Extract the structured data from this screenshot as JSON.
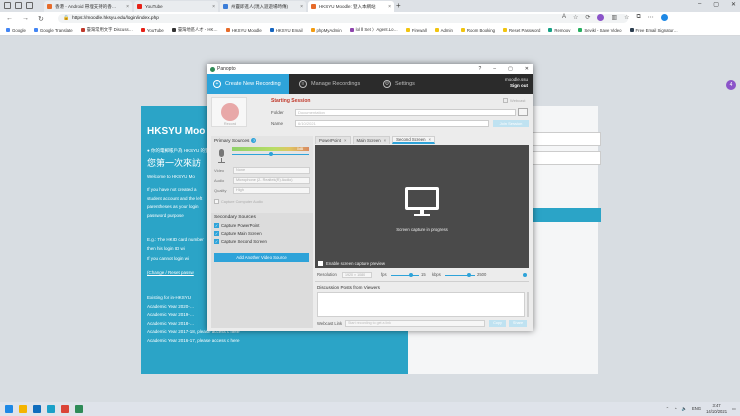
{
  "browser": {
    "tabs": [
      {
        "title": "香港 - Android 帶埋支持的香…",
        "color": "#e66b2a",
        "active": false
      },
      {
        "title": "YouTube",
        "color": "#e62117",
        "active": false
      },
      {
        "title": "州靈即進人(現入遊遊場時傳)",
        "color": "#3b7dd8",
        "active": false
      },
      {
        "title": "HKSYU Moodle: 登入本網站",
        "color": "#e66b2a",
        "active": true
      }
    ],
    "new_tab_glyph": "+",
    "url": "https://moodle.hksyu.edu/login/index.php",
    "bookmarks": [
      {
        "label": "Google",
        "color": "#4285f4"
      },
      {
        "label": "Google Translate",
        "color": "#4285f4"
      },
      {
        "label": "臺灣常用文字 Discuss…",
        "color": "#c0392b"
      },
      {
        "label": "YouTube",
        "color": "#e62117"
      },
      {
        "label": "臺灣地區人才 - HK…",
        "color": "#333333"
      },
      {
        "label": "HKSYU Moodle",
        "color": "#e66b2a"
      },
      {
        "label": "HKSYU Email",
        "color": "#1565c0"
      },
      {
        "label": "phpMyAdmin",
        "color": "#f39c12"
      },
      {
        "label": "lol Ⅱ Set 〉Agent.Lo…",
        "color": "#8e44ad"
      },
      {
        "label": "Firewall",
        "color": "#f1c40f"
      },
      {
        "label": "Admin",
        "color": "#f1c40f"
      },
      {
        "label": "Room Booking",
        "color": "#f1c40f"
      },
      {
        "label": "Reset Password",
        "color": "#f1c40f"
      },
      {
        "label": "Remoov",
        "color": "#16a085"
      },
      {
        "label": "Sevikl - Save Video",
        "color": "#27ae60"
      },
      {
        "label": "Free Email Signatur…",
        "color": "#2c3e50"
      }
    ],
    "side_badge": "4"
  },
  "background_page": {
    "heading": "HKSYU Moo",
    "line1": "● 你的電郵帳戶為 HKSYU 的登入名稱",
    "line2": "您第一次來訪",
    "line3": "Welcome to HKSYU Mo",
    "para1": "If you have not created a student account and the left parentheses as your login password purpose",
    "para2": "E.g.: The HKID card number then his login ID wi",
    "para3": "If you cannot login wi",
    "link1": "(Change / Reset passw",
    "table_lines": [
      "Existing for in-HKSYU",
      "Academic Year 2020-…",
      "Academic Year 2019-…",
      "Academic Year 2018-…",
      "Academic Year 2017-18, please access c here",
      "Academic Year 2016-17, please access c here"
    ]
  },
  "panopto": {
    "title": "Panopto",
    "window_controls": [
      "?",
      "–",
      "▢",
      "✕"
    ],
    "tabs": [
      {
        "label": "Create New Recording",
        "icon": "+",
        "active": true
      },
      {
        "label": "Manage Recordings",
        "icon": "≡",
        "active": false
      },
      {
        "label": "Settings",
        "icon": "⚙",
        "active": false
      }
    ],
    "user": {
      "name": "moodle.ssu",
      "action": "Sign out"
    },
    "record_label": "Record",
    "section_title": "Starting Session",
    "webcast_label": "Webcast",
    "folder_label": "Folder",
    "folder_value": "Documentation",
    "name_label": "Name",
    "name_value": "6/10/2021",
    "join_button": "Join Session",
    "primary_sources": {
      "title": "Primary Sources",
      "help": "?",
      "meter_label": "0dB",
      "audio_level": 0.5,
      "rows": [
        {
          "label": "Video",
          "value": "None"
        },
        {
          "label": "Audio",
          "value": "Microphone (2- Realtek(R) Audio)"
        },
        {
          "label": "Quality",
          "value": "High"
        }
      ],
      "capture_label": "Capture Computer Audio"
    },
    "secondary_sources": {
      "title": "Secondary Sources",
      "items": [
        {
          "label": "Capture PowerPoint",
          "checked": true
        },
        {
          "label": "Capture Main Screen",
          "checked": true
        },
        {
          "label": "Capture Second Screen",
          "checked": true
        }
      ],
      "add_button": "Add Another Video Source"
    },
    "source_tabs": [
      {
        "label": "PowerPoint",
        "active": false
      },
      {
        "label": "Main Screen",
        "active": false
      },
      {
        "label": "Second Screen",
        "active": true
      }
    ],
    "preview_text": "Screen capture in progress",
    "enable_preview": "Enable screen capture preview",
    "settings": {
      "resolution_label": "Resolution",
      "resolution_value": "1920 × 1080",
      "fps_label": "fps",
      "fps_value": "15",
      "fps_level": 0.7,
      "kbps_label": "kbps",
      "kbps_value": "2500",
      "kbps_level": 0.8
    },
    "discussion_title": "Discussion Posts from Viewers",
    "webcast_link_label": "Webcast Link",
    "webcast_link_placeholder": "Start recording to get a link",
    "copy_button": "Copy",
    "share_button": "Share"
  },
  "taskbar": {
    "icons": [
      {
        "name": "windows-start-icon",
        "color": "#1e88e5"
      },
      {
        "name": "file-explorer-icon",
        "color": "#f4b400"
      },
      {
        "name": "outlook-icon",
        "color": "#0f6cbd"
      },
      {
        "name": "edge-icon",
        "color": "#1aa0c8"
      },
      {
        "name": "chrome-icon",
        "color": "#db4437"
      },
      {
        "name": "panopto-icon",
        "color": "#2e8b57"
      }
    ],
    "language": "ENG",
    "time": "3:47",
    "date": "14/10/2021"
  }
}
